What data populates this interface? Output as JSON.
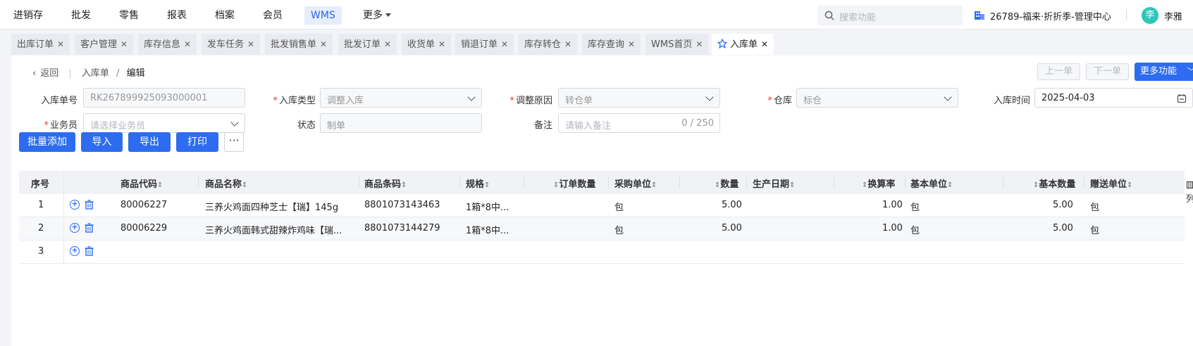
{
  "topnav": {
    "items": [
      "进销存",
      "批发",
      "零售",
      "报表",
      "档案",
      "会员",
      "WMS",
      "更多"
    ],
    "active": "WMS",
    "search_placeholder": "搜索功能",
    "org": "26789-福来·折折季-管理中心",
    "avatar_char": "李",
    "user": "李雅",
    "accent": "#2d6cf0"
  },
  "tabs": [
    "出库订单",
    "客户管理",
    "库存信息",
    "发车任务",
    "批发销售单",
    "批发订单",
    "收货单",
    "销退订单",
    "库存转仓",
    "库存查询",
    "WMS首页",
    "入库单"
  ],
  "active_tab": "入库单",
  "breadcrumb": {
    "back": "返回",
    "parent": "入库单",
    "current": "编辑"
  },
  "nav_buttons": {
    "prev": "上一单",
    "next": "下一单",
    "more": "更多功能"
  },
  "form": {
    "order_no": {
      "label": "入库单号",
      "value": "RK267899925093000001"
    },
    "in_type": {
      "label": "入库类型",
      "value": "调整入库"
    },
    "reason": {
      "label": "调整原因",
      "value": "转仓单"
    },
    "warehouse": {
      "label": "仓库",
      "value": "标仓"
    },
    "in_time": {
      "label": "入库时间",
      "value": "2025-04-03"
    },
    "staff": {
      "label": "业务员",
      "placeholder": "请选择业务员"
    },
    "status": {
      "label": "状态",
      "value": "制单"
    },
    "remark": {
      "label": "备注",
      "placeholder": "请输入备注",
      "count": "0 / 250"
    }
  },
  "actions": {
    "batch_add": "批量添加",
    "import": "导入",
    "export": "导出",
    "print": "打印",
    "more": "···"
  },
  "table": {
    "columns": [
      "序号",
      "商品代码",
      "商品名称",
      "商品条码",
      "规格",
      "订单数量",
      "采购单位",
      "数量",
      "生产日期",
      "换算率",
      "基本单位",
      "基本数量",
      "赠送单位"
    ],
    "rows": [
      {
        "idx": "1",
        "code": "80006227",
        "name": "三养火鸡面四种芝士【瑞】145g",
        "barcode": "8801073143463",
        "spec": "1箱*8中...",
        "order_qty": "",
        "unit": "包",
        "qty": "5.00",
        "prod_date": "",
        "rate": "1.00",
        "base_unit": "包",
        "base_qty": "5.00",
        "gift_unit": "包"
      },
      {
        "idx": "2",
        "code": "80006229",
        "name": "三养火鸡面韩式甜辣炸鸡味【瑞...",
        "barcode": "8801073144279",
        "spec": "1箱*8中...",
        "order_qty": "",
        "unit": "包",
        "qty": "5.00",
        "prod_date": "",
        "rate": "1.00",
        "base_unit": "包",
        "base_qty": "5.00",
        "gift_unit": "包"
      },
      {
        "idx": "3",
        "code": "",
        "name": "",
        "barcode": "",
        "spec": "",
        "order_qty": "",
        "unit": "",
        "qty": "",
        "prod_date": "",
        "rate": "",
        "base_unit": "",
        "base_qty": "",
        "gift_unit": ""
      }
    ],
    "side_label": "列"
  }
}
